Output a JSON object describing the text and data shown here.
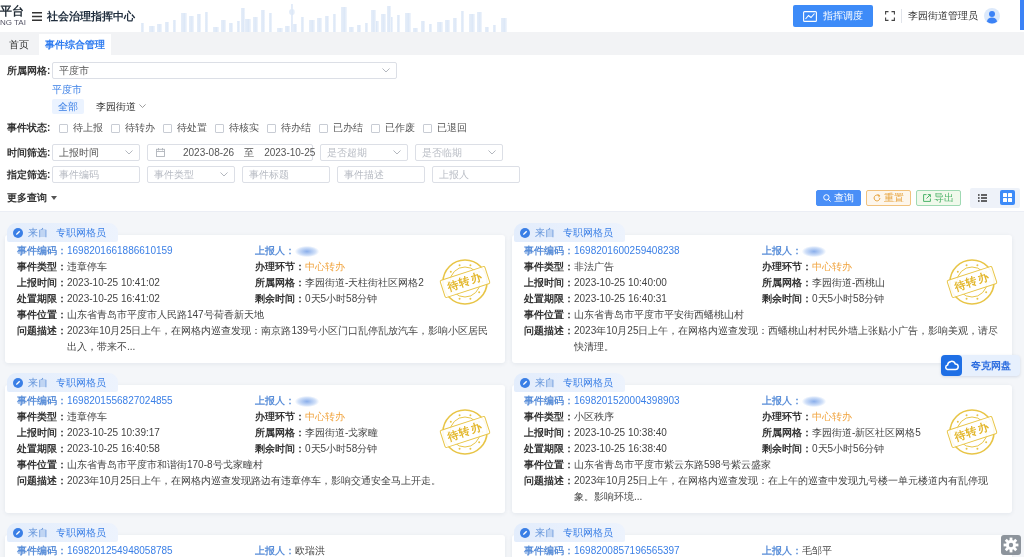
{
  "header": {
    "logo": {
      "title": "平台",
      "subtitle": "NG TAI"
    },
    "app_title": "社会治理指挥中心",
    "dispatch_button": "指挥调度",
    "user": "李园街道管理员"
  },
  "tabs": [
    {
      "label": "首页",
      "selected": false
    },
    {
      "label": "事件综合管理",
      "selected": true
    }
  ],
  "filters": {
    "grid": {
      "label": "所属网格:",
      "value": "平度市",
      "breadcrumb": "平度市",
      "options": [
        {
          "label": "全部",
          "selected": true,
          "expandable": false
        },
        {
          "label": "李园街道",
          "selected": false,
          "expandable": true
        }
      ]
    },
    "status": {
      "label": "事件状态:",
      "options": [
        {
          "label": "待上报",
          "checked": false
        },
        {
          "label": "待转办",
          "checked": false
        },
        {
          "label": "待处置",
          "checked": false
        },
        {
          "label": "待核实",
          "checked": false
        },
        {
          "label": "待办结",
          "checked": false
        },
        {
          "label": "已办结",
          "checked": false
        },
        {
          "label": "已作废",
          "checked": false
        },
        {
          "label": "已退回",
          "checked": false
        }
      ]
    },
    "time": {
      "label": "时间筛选:",
      "controls": [
        {
          "kind": "select",
          "value": "上报时间"
        },
        {
          "kind": "date_range",
          "start": "2023-08-26",
          "separator": "至",
          "end": "2023-10-25"
        },
        {
          "kind": "select",
          "placeholder": "是否超期"
        },
        {
          "kind": "select",
          "placeholder": "是否临期"
        }
      ]
    },
    "specify": {
      "label": "指定筛选:",
      "controls": [
        {
          "kind": "input",
          "placeholder": "事件编码"
        },
        {
          "kind": "select",
          "placeholder": "事件类型"
        },
        {
          "kind": "input",
          "placeholder": "事件标题"
        },
        {
          "kind": "input",
          "placeholder": "事件描述"
        },
        {
          "kind": "input",
          "placeholder": "上报人"
        }
      ]
    },
    "more_query": "更多查询"
  },
  "actions": [
    {
      "kind": "search",
      "label": "查询"
    },
    {
      "kind": "reset",
      "label": "重置"
    },
    {
      "kind": "export",
      "label": "导出"
    }
  ],
  "view_toggle": [
    {
      "kind": "list",
      "selected": false
    },
    {
      "kind": "grid",
      "selected": true
    }
  ],
  "cards": [
    {
      "tag": {
        "prefix": "来自",
        "role": "专职网格员"
      },
      "stamp": "待转办",
      "fields": [
        {
          "kind": "code",
          "label": "事件编码：",
          "value": "1698201661886610159"
        },
        {
          "kind": "reporter",
          "label": "上报人：",
          "redacted": true
        },
        {
          "kind": "text",
          "label": "事件类型：",
          "value": "违章停车"
        },
        {
          "kind": "status",
          "label": "办理环节：",
          "value": "中心转办"
        },
        {
          "kind": "text",
          "label": "上报时间：",
          "value": "2023-10-25 10:41:02"
        },
        {
          "kind": "text",
          "label": "所属网格：",
          "value": "李园街道-天柱街社区网格2"
        },
        {
          "kind": "text",
          "label": "处置期限：",
          "value": "2023-10-25 16:41:02"
        },
        {
          "kind": "text",
          "label": "剩余时间：",
          "value": "0天5小时58分钟"
        },
        {
          "kind": "wide",
          "label": "事件位置：",
          "value": "山东省青岛市平度市人民路147号荷香新天地"
        },
        {
          "kind": "wide",
          "label": "问题描述：",
          "value": "2023年10月25日上午，在网格内巡查发现：南京路139号小区门口乱停乱放汽车，影响小区居民出入，带来不..."
        }
      ]
    },
    {
      "tag": {
        "prefix": "来自",
        "role": "专职网格员"
      },
      "stamp": "待转办",
      "fields": [
        {
          "kind": "code",
          "label": "事件编码：",
          "value": "1698201600259408238"
        },
        {
          "kind": "reporter",
          "label": "上报人：",
          "redacted": true
        },
        {
          "kind": "text",
          "label": "事件类型：",
          "value": "非法广告"
        },
        {
          "kind": "status",
          "label": "办理环节：",
          "value": "中心转办"
        },
        {
          "kind": "text",
          "label": "上报时间：",
          "value": "2023-10-25 10:40:00"
        },
        {
          "kind": "text",
          "label": "所属网格：",
          "value": "李园街道-西桃山"
        },
        {
          "kind": "text",
          "label": "处置期限：",
          "value": "2023-10-25 16:40:31"
        },
        {
          "kind": "text",
          "label": "剩余时间：",
          "value": "0天5小时58分钟"
        },
        {
          "kind": "wide",
          "label": "事件位置：",
          "value": "山东省青岛市平度市平安街西蟠桃山村"
        },
        {
          "kind": "wide",
          "label": "问题描述：",
          "value": "2023年10月25日上午，在网格内巡查发现：西蟠桃山村村民外墙上张贴小广告，影响美观，请尽快清理。"
        }
      ]
    },
    {
      "tag": {
        "prefix": "来自",
        "role": "专职网格员"
      },
      "stamp": "待转办",
      "fields": [
        {
          "kind": "code",
          "label": "事件编码：",
          "value": "1698201556827024855"
        },
        {
          "kind": "reporter",
          "label": "上报人：",
          "redacted": true
        },
        {
          "kind": "text",
          "label": "事件类型：",
          "value": "违章停车"
        },
        {
          "kind": "status",
          "label": "办理环节：",
          "value": "中心转办"
        },
        {
          "kind": "text",
          "label": "上报时间：",
          "value": "2023-10-25 10:39:17"
        },
        {
          "kind": "text",
          "label": "所属网格：",
          "value": "李园街道-戈家疃"
        },
        {
          "kind": "text",
          "label": "处置期限：",
          "value": "2023-10-25 16:40:58"
        },
        {
          "kind": "text",
          "label": "剩余时间：",
          "value": "0天5小时58分钟"
        },
        {
          "kind": "wide",
          "label": "事件位置：",
          "value": "山东省青岛市平度市和谐街170-8号戈家疃村"
        },
        {
          "kind": "wide",
          "label": "问题描述：",
          "value": "2023年10月25日上午，在网格内巡查发现路边有违章停车，影响交通安全马上开走。"
        }
      ]
    },
    {
      "tag": {
        "prefix": "来自",
        "role": "专职网格员"
      },
      "stamp": "待转办",
      "fields": [
        {
          "kind": "code",
          "label": "事件编码：",
          "value": "1698201520004398903"
        },
        {
          "kind": "reporter",
          "label": "上报人：",
          "redacted": true
        },
        {
          "kind": "text",
          "label": "事件类型：",
          "value": "小区秩序"
        },
        {
          "kind": "status",
          "label": "办理环节：",
          "value": "中心转办"
        },
        {
          "kind": "text",
          "label": "上报时间：",
          "value": "2023-10-25 10:38:40"
        },
        {
          "kind": "text",
          "label": "所属网格：",
          "value": "李园街道-新区社区网格5"
        },
        {
          "kind": "text",
          "label": "处置期限：",
          "value": "2023-10-25 16:38:40"
        },
        {
          "kind": "text",
          "label": "剩余时间：",
          "value": "0天5小时56分钟"
        },
        {
          "kind": "wide",
          "label": "事件位置：",
          "value": "山东省青岛市平度市紫云东路598号紫云盛家"
        },
        {
          "kind": "wide",
          "label": "问题描述：",
          "value": "2023年10月25日上午，在网格内巡查发现：在上午的巡查中发现九号楼一单元楼道内有乱停现象。影响环境..."
        }
      ]
    },
    {
      "tag": {
        "prefix": "来自",
        "role": "专职网格员"
      },
      "fields": [
        {
          "kind": "code",
          "label": "事件编码：",
          "value": "1698201254948058785"
        },
        {
          "kind": "reporter",
          "label": "上报人：",
          "redacted": false,
          "value": "欧瑞洪"
        }
      ]
    },
    {
      "tag": {
        "prefix": "来自",
        "role": "专职网格员"
      },
      "fields": [
        {
          "kind": "code",
          "label": "事件编码：",
          "value": "1698200857196565397"
        },
        {
          "kind": "reporter",
          "label": "上报人：",
          "redacted": false,
          "value": "毛邹平"
        }
      ]
    }
  ],
  "cloud_widget": {
    "label": "夸克网盘"
  }
}
